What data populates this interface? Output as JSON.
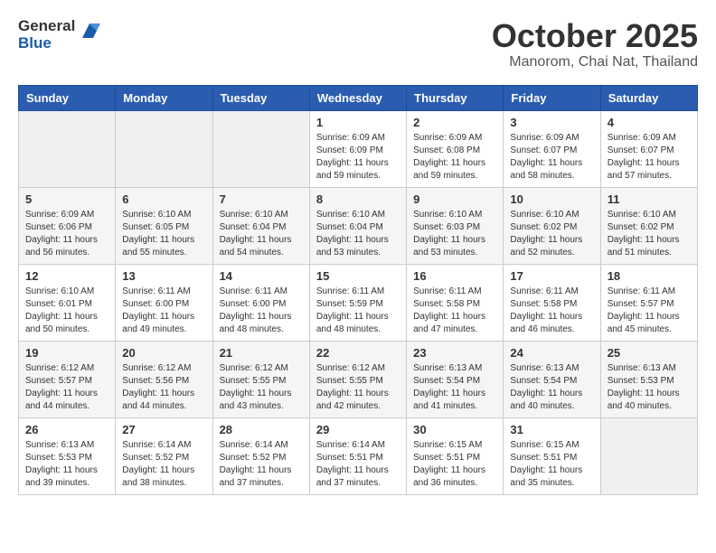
{
  "header": {
    "logo_general": "General",
    "logo_blue": "Blue",
    "month_title": "October 2025",
    "location": "Manorom, Chai Nat, Thailand"
  },
  "weekdays": [
    "Sunday",
    "Monday",
    "Tuesday",
    "Wednesday",
    "Thursday",
    "Friday",
    "Saturday"
  ],
  "weeks": [
    [
      {
        "day": "",
        "info": ""
      },
      {
        "day": "",
        "info": ""
      },
      {
        "day": "",
        "info": ""
      },
      {
        "day": "1",
        "info": "Sunrise: 6:09 AM\nSunset: 6:09 PM\nDaylight: 11 hours\nand 59 minutes."
      },
      {
        "day": "2",
        "info": "Sunrise: 6:09 AM\nSunset: 6:08 PM\nDaylight: 11 hours\nand 59 minutes."
      },
      {
        "day": "3",
        "info": "Sunrise: 6:09 AM\nSunset: 6:07 PM\nDaylight: 11 hours\nand 58 minutes."
      },
      {
        "day": "4",
        "info": "Sunrise: 6:09 AM\nSunset: 6:07 PM\nDaylight: 11 hours\nand 57 minutes."
      }
    ],
    [
      {
        "day": "5",
        "info": "Sunrise: 6:09 AM\nSunset: 6:06 PM\nDaylight: 11 hours\nand 56 minutes."
      },
      {
        "day": "6",
        "info": "Sunrise: 6:10 AM\nSunset: 6:05 PM\nDaylight: 11 hours\nand 55 minutes."
      },
      {
        "day": "7",
        "info": "Sunrise: 6:10 AM\nSunset: 6:04 PM\nDaylight: 11 hours\nand 54 minutes."
      },
      {
        "day": "8",
        "info": "Sunrise: 6:10 AM\nSunset: 6:04 PM\nDaylight: 11 hours\nand 53 minutes."
      },
      {
        "day": "9",
        "info": "Sunrise: 6:10 AM\nSunset: 6:03 PM\nDaylight: 11 hours\nand 53 minutes."
      },
      {
        "day": "10",
        "info": "Sunrise: 6:10 AM\nSunset: 6:02 PM\nDaylight: 11 hours\nand 52 minutes."
      },
      {
        "day": "11",
        "info": "Sunrise: 6:10 AM\nSunset: 6:02 PM\nDaylight: 11 hours\nand 51 minutes."
      }
    ],
    [
      {
        "day": "12",
        "info": "Sunrise: 6:10 AM\nSunset: 6:01 PM\nDaylight: 11 hours\nand 50 minutes."
      },
      {
        "day": "13",
        "info": "Sunrise: 6:11 AM\nSunset: 6:00 PM\nDaylight: 11 hours\nand 49 minutes."
      },
      {
        "day": "14",
        "info": "Sunrise: 6:11 AM\nSunset: 6:00 PM\nDaylight: 11 hours\nand 48 minutes."
      },
      {
        "day": "15",
        "info": "Sunrise: 6:11 AM\nSunset: 5:59 PM\nDaylight: 11 hours\nand 48 minutes."
      },
      {
        "day": "16",
        "info": "Sunrise: 6:11 AM\nSunset: 5:58 PM\nDaylight: 11 hours\nand 47 minutes."
      },
      {
        "day": "17",
        "info": "Sunrise: 6:11 AM\nSunset: 5:58 PM\nDaylight: 11 hours\nand 46 minutes."
      },
      {
        "day": "18",
        "info": "Sunrise: 6:11 AM\nSunset: 5:57 PM\nDaylight: 11 hours\nand 45 minutes."
      }
    ],
    [
      {
        "day": "19",
        "info": "Sunrise: 6:12 AM\nSunset: 5:57 PM\nDaylight: 11 hours\nand 44 minutes."
      },
      {
        "day": "20",
        "info": "Sunrise: 6:12 AM\nSunset: 5:56 PM\nDaylight: 11 hours\nand 44 minutes."
      },
      {
        "day": "21",
        "info": "Sunrise: 6:12 AM\nSunset: 5:55 PM\nDaylight: 11 hours\nand 43 minutes."
      },
      {
        "day": "22",
        "info": "Sunrise: 6:12 AM\nSunset: 5:55 PM\nDaylight: 11 hours\nand 42 minutes."
      },
      {
        "day": "23",
        "info": "Sunrise: 6:13 AM\nSunset: 5:54 PM\nDaylight: 11 hours\nand 41 minutes."
      },
      {
        "day": "24",
        "info": "Sunrise: 6:13 AM\nSunset: 5:54 PM\nDaylight: 11 hours\nand 40 minutes."
      },
      {
        "day": "25",
        "info": "Sunrise: 6:13 AM\nSunset: 5:53 PM\nDaylight: 11 hours\nand 40 minutes."
      }
    ],
    [
      {
        "day": "26",
        "info": "Sunrise: 6:13 AM\nSunset: 5:53 PM\nDaylight: 11 hours\nand 39 minutes."
      },
      {
        "day": "27",
        "info": "Sunrise: 6:14 AM\nSunset: 5:52 PM\nDaylight: 11 hours\nand 38 minutes."
      },
      {
        "day": "28",
        "info": "Sunrise: 6:14 AM\nSunset: 5:52 PM\nDaylight: 11 hours\nand 37 minutes."
      },
      {
        "day": "29",
        "info": "Sunrise: 6:14 AM\nSunset: 5:51 PM\nDaylight: 11 hours\nand 37 minutes."
      },
      {
        "day": "30",
        "info": "Sunrise: 6:15 AM\nSunset: 5:51 PM\nDaylight: 11 hours\nand 36 minutes."
      },
      {
        "day": "31",
        "info": "Sunrise: 6:15 AM\nSunset: 5:51 PM\nDaylight: 11 hours\nand 35 minutes."
      },
      {
        "day": "",
        "info": ""
      }
    ]
  ]
}
